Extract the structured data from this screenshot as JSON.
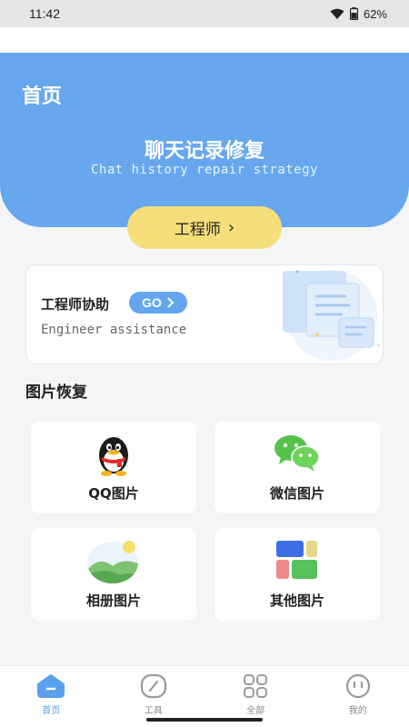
{
  "status": {
    "time": "11:42",
    "battery": "62%"
  },
  "header": {
    "title": "首页"
  },
  "hero": {
    "title": "聊天记录修复",
    "subtitle": "Chat history repair strategy"
  },
  "engineer_button": {
    "label": "工程师",
    "chevron": "›"
  },
  "assist_card": {
    "title": "工程师协助",
    "go_label": "GO",
    "subtitle": "Engineer assistance"
  },
  "section": {
    "title": "图片恢复"
  },
  "tiles": [
    {
      "label": "QQ图片",
      "icon": "qq-penguin-icon"
    },
    {
      "label": "微信图片",
      "icon": "wechat-icon"
    },
    {
      "label": "相册图片",
      "icon": "album-landscape-icon"
    },
    {
      "label": "其他图片",
      "icon": "other-blocks-icon"
    }
  ],
  "nav": [
    {
      "label": "首页",
      "icon": "home-icon",
      "active": true
    },
    {
      "label": "工具",
      "icon": "tools-icon",
      "active": false
    },
    {
      "label": "全部",
      "icon": "grid-icon",
      "active": false
    },
    {
      "label": "我的",
      "icon": "profile-face-icon",
      "active": false
    }
  ],
  "colors": {
    "primary": "#66a7ee",
    "accent_yellow": "#f6df7a",
    "background": "#f4f5f7"
  }
}
